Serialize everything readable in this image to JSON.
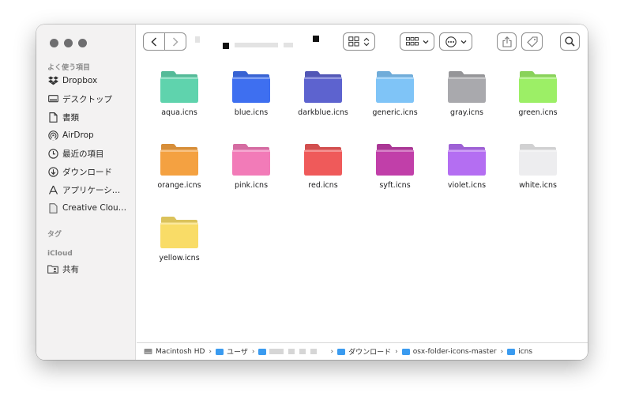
{
  "sidebar": {
    "favorites_header": "よく使う項目",
    "favorites": [
      {
        "label": "Dropbox",
        "icon": "dropbox-icon"
      },
      {
        "label": "デスクトップ",
        "icon": "desktop-icon"
      },
      {
        "label": "書類",
        "icon": "document-icon"
      },
      {
        "label": "AirDrop",
        "icon": "airdrop-icon"
      },
      {
        "label": "最近の項目",
        "icon": "clock-icon"
      },
      {
        "label": "ダウンロード",
        "icon": "download-icon"
      },
      {
        "label": "アプリケーシ…",
        "icon": "applications-icon"
      },
      {
        "label": "Creative Clou…",
        "icon": "file-icon"
      }
    ],
    "tags_header": "タグ",
    "icloud_header": "iCloud",
    "icloud_items": [
      {
        "label": "共有",
        "icon": "shared-folder-icon"
      }
    ]
  },
  "files": [
    {
      "name": "aqua.icns",
      "color": "#5fd3ad"
    },
    {
      "name": "blue.icns",
      "color": "#3e6ff0"
    },
    {
      "name": "darkblue.icns",
      "color": "#5d63cf"
    },
    {
      "name": "generic.icns",
      "color": "#7fc4f7"
    },
    {
      "name": "gray.icns",
      "color": "#a9a9ad"
    },
    {
      "name": "green.icns",
      "color": "#9cef66"
    },
    {
      "name": "orange.icns",
      "color": "#f4a141"
    },
    {
      "name": "pink.icns",
      "color": "#f27bb8"
    },
    {
      "name": "red.icns",
      "color": "#ef5a5a"
    },
    {
      "name": "syft.icns",
      "color": "#c13fa9"
    },
    {
      "name": "violet.icns",
      "color": "#b46ef2"
    },
    {
      "name": "white.icns",
      "color": "#ededef"
    },
    {
      "name": "yellow.icns",
      "color": "#f9dc67"
    }
  ],
  "pathbar": {
    "disk": "Macintosh HD",
    "users": "ユーザ",
    "downloads": "ダウンロード",
    "repo": "osx-folder-icons-master",
    "current": "icns"
  }
}
